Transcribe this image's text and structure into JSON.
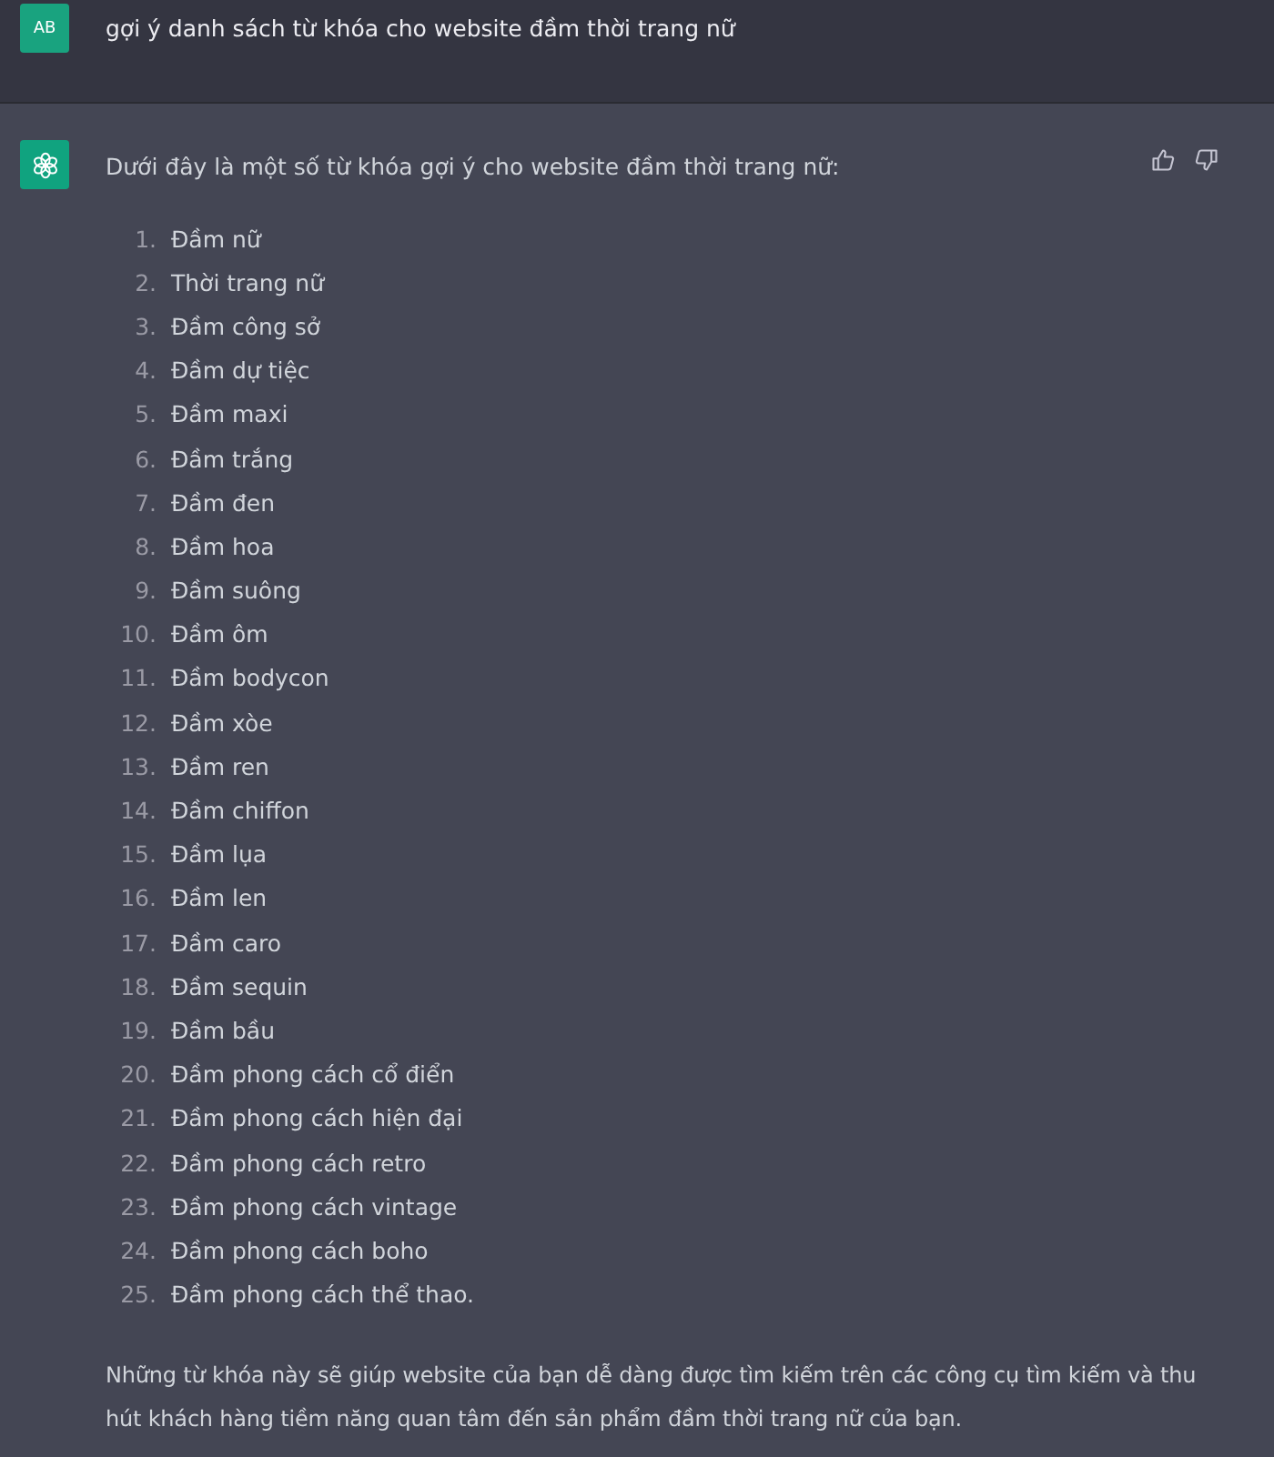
{
  "user_message": {
    "avatar": "AB",
    "text": "gợi ý danh sách từ khóa cho website đầm thời trang nữ"
  },
  "assistant_message": {
    "intro": "Dưới đây là một số từ khóa gợi ý cho website đầm thời trang nữ:",
    "list": [
      {
        "number": "1.",
        "text": "Đầm nữ"
      },
      {
        "number": "2.",
        "text": "Thời trang nữ"
      },
      {
        "number": "3.",
        "text": "Đầm công sở"
      },
      {
        "number": "4.",
        "text": "Đầm dự tiệc"
      },
      {
        "number": "5.",
        "text": "Đầm maxi"
      },
      {
        "number": "6.",
        "text": "Đầm trắng"
      },
      {
        "number": "7.",
        "text": "Đầm đen"
      },
      {
        "number": "8.",
        "text": "Đầm hoa"
      },
      {
        "number": "9.",
        "text": "Đầm suông"
      },
      {
        "number": "10.",
        "text": "Đầm ôm"
      },
      {
        "number": "11.",
        "text": "Đầm bodycon"
      },
      {
        "number": "12.",
        "text": "Đầm xòe"
      },
      {
        "number": "13.",
        "text": "Đầm ren"
      },
      {
        "number": "14.",
        "text": "Đầm chiffon"
      },
      {
        "number": "15.",
        "text": "Đầm lụa"
      },
      {
        "number": "16.",
        "text": "Đầm len"
      },
      {
        "number": "17.",
        "text": "Đầm caro"
      },
      {
        "number": "18.",
        "text": "Đầm sequin"
      },
      {
        "number": "19.",
        "text": "Đầm bầu"
      },
      {
        "number": "20.",
        "text": "Đầm phong cách cổ điển"
      },
      {
        "number": "21.",
        "text": "Đầm phong cách hiện đại"
      },
      {
        "number": "22.",
        "text": "Đầm phong cách retro"
      },
      {
        "number": "23.",
        "text": "Đầm phong cách vintage"
      },
      {
        "number": "24.",
        "text": "Đầm phong cách boho"
      },
      {
        "number": "25.",
        "text": "Đầm phong cách thể thao."
      }
    ],
    "closing": "Những từ khóa này sẽ giúp website của bạn dễ dàng được tìm kiếm trên các công cụ tìm kiếm và thu hút khách hàng tiềm năng quan tâm đến sản phẩm đầm thời trang nữ của bạn."
  }
}
